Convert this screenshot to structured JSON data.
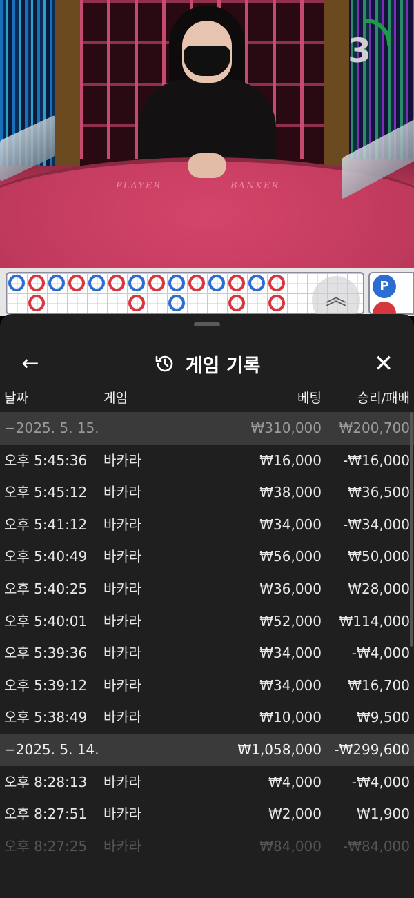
{
  "video": {
    "table_labels": {
      "player": "PLAYER",
      "banker": "BANKER"
    },
    "countdown": "3",
    "countdown_remaining_fraction": 0.25
  },
  "road": {
    "beads": [
      {
        "col": 0,
        "row": 0,
        "result": "P"
      },
      {
        "col": 1,
        "row": 0,
        "result": "B"
      },
      {
        "col": 2,
        "row": 0,
        "result": "P"
      },
      {
        "col": 3,
        "row": 0,
        "result": "B"
      },
      {
        "col": 4,
        "row": 0,
        "result": "P"
      },
      {
        "col": 5,
        "row": 0,
        "result": "B"
      },
      {
        "col": 6,
        "row": 0,
        "result": "P"
      },
      {
        "col": 7,
        "row": 0,
        "result": "B"
      },
      {
        "col": 8,
        "row": 0,
        "result": "P"
      },
      {
        "col": 9,
        "row": 0,
        "result": "B"
      },
      {
        "col": 10,
        "row": 0,
        "result": "P"
      },
      {
        "col": 11,
        "row": 0,
        "result": "B"
      },
      {
        "col": 12,
        "row": 0,
        "result": "P"
      },
      {
        "col": 13,
        "row": 0,
        "result": "B"
      },
      {
        "col": 1,
        "row": 1,
        "result": "B"
      },
      {
        "col": 6,
        "row": 1,
        "result": "B"
      },
      {
        "col": 8,
        "row": 1,
        "result": "P"
      },
      {
        "col": 11,
        "row": 1,
        "result": "B"
      },
      {
        "col": 13,
        "row": 1,
        "result": "B"
      }
    ],
    "prediction_label": "P"
  },
  "sheet": {
    "title": "게임 기록",
    "columns": {
      "date": "날짜",
      "game": "게임",
      "bet": "베팅",
      "result": "승리/패배"
    },
    "rows": [
      {
        "type": "group",
        "date": "−2025. 5. 15.",
        "game": "",
        "bet": "₩310,000",
        "result": "₩200,700",
        "style": "dim"
      },
      {
        "type": "item",
        "date": "오후 5:45:36",
        "game": "바카라",
        "bet": "₩16,000",
        "result": "-₩16,000"
      },
      {
        "type": "item",
        "date": "오후 5:45:12",
        "game": "바카라",
        "bet": "₩38,000",
        "result": "₩36,500"
      },
      {
        "type": "item",
        "date": "오후 5:41:12",
        "game": "바카라",
        "bet": "₩34,000",
        "result": "-₩34,000"
      },
      {
        "type": "item",
        "date": "오후 5:40:49",
        "game": "바카라",
        "bet": "₩56,000",
        "result": "₩50,000"
      },
      {
        "type": "item",
        "date": "오후 5:40:25",
        "game": "바카라",
        "bet": "₩36,000",
        "result": "₩28,000"
      },
      {
        "type": "item",
        "date": "오후 5:40:01",
        "game": "바카라",
        "bet": "₩52,000",
        "result": "₩114,000"
      },
      {
        "type": "item",
        "date": "오후 5:39:36",
        "game": "바카라",
        "bet": "₩34,000",
        "result": "-₩4,000"
      },
      {
        "type": "item",
        "date": "오후 5:39:12",
        "game": "바카라",
        "bet": "₩34,000",
        "result": "₩16,700"
      },
      {
        "type": "item",
        "date": "오후 5:38:49",
        "game": "바카라",
        "bet": "₩10,000",
        "result": "₩9,500"
      },
      {
        "type": "group",
        "date": "−2025. 5. 14.",
        "game": "",
        "bet": "₩1,058,000",
        "result": "-₩299,600",
        "style": "strong"
      },
      {
        "type": "item",
        "date": "오후 8:28:13",
        "game": "바카라",
        "bet": "₩4,000",
        "result": "-₩4,000"
      },
      {
        "type": "item",
        "date": "오후 8:27:51",
        "game": "바카라",
        "bet": "₩2,000",
        "result": "₩1,900"
      },
      {
        "type": "item",
        "date": "오후 8:27:25",
        "game": "바카라",
        "bet": "₩84,000",
        "result": "-₩84,000",
        "style": "faded"
      }
    ]
  }
}
